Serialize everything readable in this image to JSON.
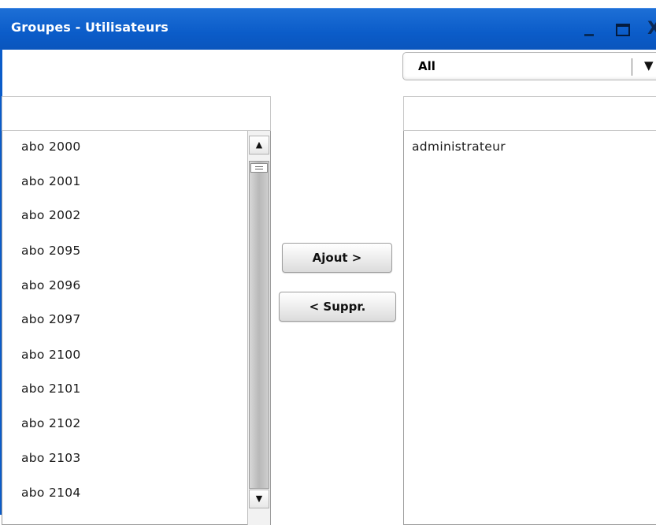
{
  "window": {
    "title": "Groupes - Utilisateurs",
    "close_glyph": "X"
  },
  "filter": {
    "selected": "All",
    "arrow": "▼"
  },
  "available_list": {
    "items": [
      "abo 2000",
      "abo 2001",
      "abo 2002",
      "abo 2095",
      "abo 2096",
      "abo 2097",
      "abo 2100",
      "abo 2101",
      "abo 2102",
      "abo 2103",
      "abo 2104"
    ]
  },
  "assigned_list": {
    "items": [
      "administrateur"
    ]
  },
  "actions": {
    "add_label": "Ajout >",
    "remove_label": "< Suppr."
  },
  "scrollbar": {
    "up_glyph": "▲",
    "down_glyph": "▼"
  },
  "colors": {
    "titlebar": "#0b5cc9",
    "title_text": "#ffffff"
  }
}
